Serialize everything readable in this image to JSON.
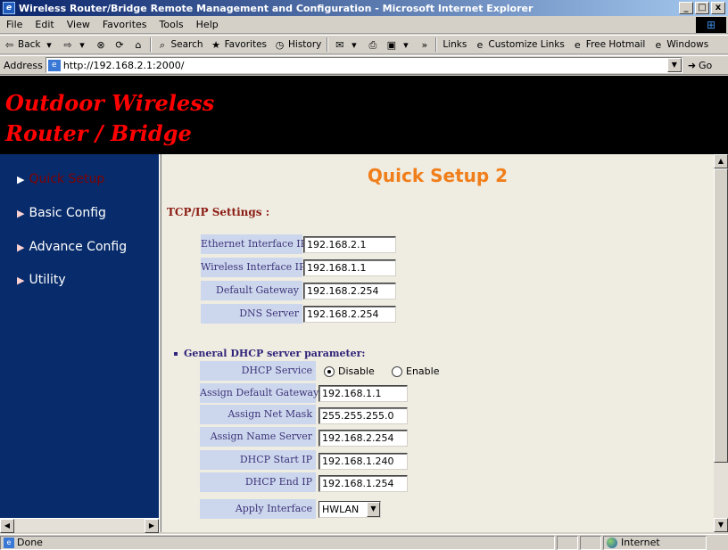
{
  "window": {
    "title": "Wireless Router/Bridge Remote Management and Configuration - Microsoft Internet Explorer",
    "minimize": "_",
    "maximize": "□",
    "close": "x"
  },
  "menu": [
    "File",
    "Edit",
    "View",
    "Favorites",
    "Tools",
    "Help"
  ],
  "toolbar": {
    "back": "Back",
    "search": "Search",
    "favorites": "Favorites",
    "history": "History",
    "links": "Links",
    "customize_links": "Customize Links",
    "free_hotmail": "Free Hotmail",
    "windows": "Windows"
  },
  "address": {
    "label": "Address",
    "url": "http://192.168.2.1:2000/",
    "go": "Go"
  },
  "banner": {
    "line1": "Outdoor Wireless",
    "line2": "Router / Bridge"
  },
  "sidebar": {
    "items": [
      {
        "label": "Quick Setup",
        "active": true
      },
      {
        "label": "Basic Config",
        "active": false
      },
      {
        "label": "Advance Config",
        "active": false
      },
      {
        "label": "Utility",
        "active": false
      }
    ]
  },
  "main": {
    "title": "Quick Setup 2",
    "tcpip_heading": "TCP/IP Settings :",
    "tcpip_fields": [
      {
        "label": "Ethernet Interface IP",
        "value": "192.168.2.1"
      },
      {
        "label": "Wireless Interface IP",
        "value": "192.168.1.1"
      },
      {
        "label": "Default Gateway",
        "value": "192.168.2.254"
      },
      {
        "label": "DNS Server",
        "value": "192.168.2.254"
      }
    ],
    "dhcp_heading": "General DHCP server parameter:",
    "dhcp_service": {
      "label": "DHCP Service",
      "option_disable": "Disable",
      "option_enable": "Enable",
      "selected": "Disable"
    },
    "dhcp_fields": [
      {
        "label": "Assign Default Gateway",
        "value": "192.168.1.1"
      },
      {
        "label": "Assign Net Mask",
        "value": "255.255.255.0"
      },
      {
        "label": "Assign Name Server",
        "value": "192.168.2.254"
      },
      {
        "label": "DHCP Start IP",
        "value": "192.168.1.240"
      },
      {
        "label": "DHCP End IP",
        "value": "192.168.1.254"
      }
    ],
    "apply_interface": {
      "label": "Apply Interface",
      "value": "HWLAN"
    }
  },
  "status": {
    "text": "Done",
    "zone": "Internet"
  },
  "colors": {
    "banner_text": "#ff0000",
    "sidebar_bg": "#082c6b",
    "title_orange": "#f07e1a",
    "label_bg": "#ccd7ee"
  }
}
